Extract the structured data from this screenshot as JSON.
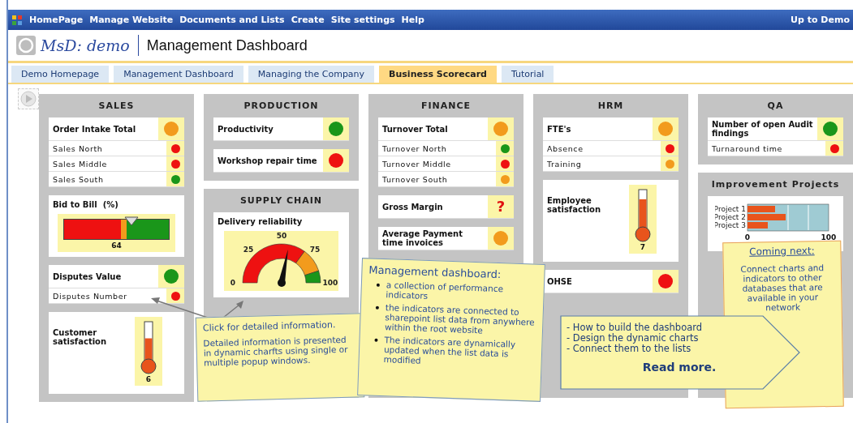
{
  "top_nav": {
    "items": [
      "HomePage",
      "Manage Website",
      "Documents and Lists",
      "Create",
      "Site settings",
      "Help"
    ],
    "right": "Up to Demo"
  },
  "header": {
    "logo": "MsD: demo",
    "title": "Management Dashboard"
  },
  "tabs": [
    {
      "label": "Demo Homepage",
      "selected": false
    },
    {
      "label": "Management Dashboard",
      "selected": false
    },
    {
      "label": "Managing the Company",
      "selected": false
    },
    {
      "label": "Business Scorecard",
      "selected": true
    },
    {
      "label": "Tutorial",
      "selected": false
    }
  ],
  "columns": [
    {
      "panels": [
        {
          "title": "SALES",
          "widgets": [
            {
              "kind": "indicators",
              "items": [
                {
                  "kind": "total",
                  "label": "Order Intake Total",
                  "color": "#f29b1d"
                },
                {
                  "kind": "detail",
                  "label": "Sales North",
                  "color": "#ee1111"
                },
                {
                  "kind": "detail",
                  "label": "Sales Middle",
                  "color": "#ee1111"
                },
                {
                  "kind": "detail",
                  "label": "Sales South",
                  "color": "#1a961a"
                }
              ]
            },
            {
              "kind": "bar",
              "label": "Bid to Bill  (%)",
              "level": 0.64,
              "reading": "64"
            },
            {
              "kind": "indicators",
              "items": [
                {
                  "kind": "total",
                  "label": "Disputes Value",
                  "color": "#1a961a"
                },
                {
                  "kind": "detail",
                  "label": "Disputes Number",
                  "color": "#ee1111"
                }
              ]
            },
            {
              "kind": "thermometer",
              "label": "Customer satisfaction",
              "level": 0.62,
              "reading": "6"
            }
          ]
        }
      ]
    },
    {
      "panels": [
        {
          "title": "PRODUCTION",
          "widgets": [
            {
              "kind": "indicators",
              "items": [
                {
                  "kind": "total",
                  "label": "Productivity",
                  "color": "#1a961a"
                }
              ]
            },
            {
              "kind": "indicators",
              "items": [
                {
                  "kind": "total",
                  "label": "Workshop repair time",
                  "color": "#ee1111"
                }
              ]
            }
          ]
        },
        {
          "title": "SUPPLY CHAIN",
          "widgets": [
            {
              "kind": "dial",
              "label": "Delivery reliability",
              "level": 0.56,
              "ticks": [
                "0",
                "25",
                "50",
                "75",
                "100"
              ]
            }
          ]
        }
      ]
    },
    {
      "panels": [
        {
          "title": "FINANCE",
          "widgets": [
            {
              "kind": "indicators",
              "items": [
                {
                  "kind": "total",
                  "label": "Turnover Total",
                  "color": "#f29b1d"
                },
                {
                  "kind": "detail",
                  "label": "Turnover North",
                  "color": "#1a961a"
                },
                {
                  "kind": "detail",
                  "label": "Turnover Middle",
                  "color": "#ee1111"
                },
                {
                  "kind": "detail",
                  "label": "Turnover South",
                  "color": "#f29b1d"
                }
              ]
            },
            {
              "kind": "indicators",
              "items": [
                {
                  "kind": "total",
                  "label": "Gross Margin",
                  "symbol": "?"
                }
              ]
            },
            {
              "kind": "indicators",
              "items": [
                {
                  "kind": "total",
                  "label": "Average Payment time invoices",
                  "color": "#f29b1d"
                }
              ]
            }
          ]
        }
      ]
    },
    {
      "panels": [
        {
          "title": "HRM",
          "widgets": [
            {
              "kind": "indicators",
              "items": [
                {
                  "kind": "total",
                  "label": "FTE's",
                  "color": "#f29b1d"
                },
                {
                  "kind": "detail",
                  "label": "Absence",
                  "color": "#ee1111"
                },
                {
                  "kind": "detail",
                  "label": "Training",
                  "color": "#f29b1d"
                }
              ]
            },
            {
              "kind": "thermometer",
              "label": "Employee satisfaction",
              "level": 0.78,
              "reading": "7"
            },
            {
              "kind": "indicators",
              "items": [
                {
                  "kind": "total",
                  "label": "OHSE",
                  "color": "#ee1111"
                }
              ]
            }
          ]
        }
      ]
    },
    {
      "panels": [
        {
          "title": "QA",
          "widgets": [
            {
              "kind": "indicators",
              "items": [
                {
                  "kind": "total",
                  "label": "Number of open Audit findings",
                  "color": "#1a961a"
                },
                {
                  "kind": "detail",
                  "label": "Turnaround time",
                  "color": "#ee1111"
                }
              ]
            }
          ]
        },
        {
          "title": "Improvement Projects",
          "widgets": [
            {
              "kind": "chart",
              "chart_data": {
                "type": "bar",
                "orientation": "horizontal",
                "categories": [
                  "Project 1",
                  "Project 2",
                  "Project 3"
                ],
                "series": [
                  {
                    "color": "#e8541c",
                    "values": [
                      34,
                      47,
                      25
                    ]
                  }
                ],
                "xlim": [
                  0,
                  100
                ],
                "xticks": [
                  0,
                  100
                ]
              }
            }
          ]
        }
      ]
    }
  ],
  "callouts": [
    {
      "kind": "note",
      "title": "Click for detailed information.",
      "text": "Detailed information is presented in dynamic charfts using single or multiple popup windows."
    },
    {
      "kind": "bullets",
      "title": "Management dashboard:",
      "items": [
        "a collection of performance indicators",
        "the indicators are connected to sharepoint list data from anywhere within the root website",
        "The indicators are dynamically updated when the list data is modified"
      ]
    },
    {
      "kind": "arrow",
      "items": [
        "- How to build the dashboard",
        "- Design the dynamic charts",
        "- Connect them to the lists"
      ],
      "link": "Read more."
    },
    {
      "kind": "next",
      "title": "Coming next:",
      "text": "Connect charts and indicators to other databases that are available in your network"
    }
  ]
}
